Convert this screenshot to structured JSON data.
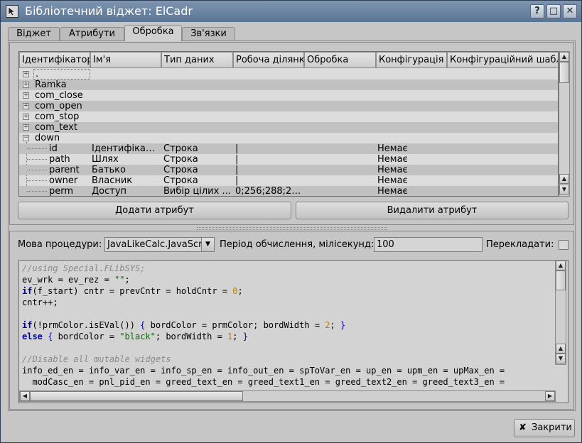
{
  "window": {
    "title": "Бібліотечний віджет: ElCadr",
    "title_buttons": [
      {
        "name": "help",
        "glyph": "?"
      },
      {
        "name": "maximize",
        "glyph": "□"
      },
      {
        "name": "close",
        "glyph": "✕"
      }
    ]
  },
  "tabs": [
    {
      "label": "Віджет",
      "active": false
    },
    {
      "label": "Атрибути",
      "active": false
    },
    {
      "label": "Обробка",
      "active": true
    },
    {
      "label": "Зв'язки",
      "active": false
    }
  ],
  "tree": {
    "columns": [
      "Ідентифікатор",
      "Ім'я",
      "Тип даних",
      "Робоча ділянка",
      "Обробка",
      "Конфігурація",
      "Конфігураційний шаблон"
    ],
    "rows": [
      {
        "id": ".",
        "level": 0,
        "expander": "+"
      },
      {
        "id": "Ramka",
        "level": 0,
        "expander": "+"
      },
      {
        "id": "com_close",
        "level": 0,
        "expander": "+"
      },
      {
        "id": "com_open",
        "level": 0,
        "expander": "+"
      },
      {
        "id": "com_stop",
        "level": 0,
        "expander": "+"
      },
      {
        "id": "com_text",
        "level": 0,
        "expander": "+"
      },
      {
        "id": "down",
        "level": 0,
        "expander": "−"
      },
      {
        "id": "id",
        "level": 1,
        "name": "Ідентифіка…",
        "type": "Строка",
        "work": "|",
        "config": "Немає"
      },
      {
        "id": "path",
        "level": 1,
        "name": "Шлях",
        "type": "Строка",
        "work": "|",
        "config": "Немає"
      },
      {
        "id": "parent",
        "level": 1,
        "name": "Батько",
        "type": "Строка",
        "work": "|",
        "config": "Немає"
      },
      {
        "id": "owner",
        "level": 1,
        "name": "Власник",
        "type": "Строка",
        "work": "|",
        "config": "Немає"
      },
      {
        "id": "perm",
        "level": 1,
        "name": "Доступ",
        "type": "Вибір цілих …",
        "work": "0;256;288;2…",
        "config": "Немає"
      }
    ]
  },
  "buttons": {
    "add_attr": "Додати атрибут",
    "del_attr": "Видалити атрибут",
    "close": "Закрити"
  },
  "procedure": {
    "lang_label": "Мова процедури:",
    "lang_value": "JavaLikeCalc.JavaScript",
    "period_label": "Період обчислення, мілісекунд:",
    "period_value": "100",
    "translate_label": "Перекладати:",
    "translate_checked": false
  },
  "code_lines": [
    [
      {
        "t": "//using Special.FLibSYS;",
        "c": "cm"
      }
    ],
    [
      {
        "t": "ev_wrk = ev_rez = ",
        "c": ""
      },
      {
        "t": "\"\"",
        "c": "st"
      },
      {
        "t": ";",
        "c": ""
      }
    ],
    [
      {
        "t": "if",
        "c": "kw"
      },
      {
        "t": "(f_start) cntr = prevCntr = holdCntr = ",
        "c": ""
      },
      {
        "t": "0",
        "c": "nm"
      },
      {
        "t": ";",
        "c": ""
      }
    ],
    [
      {
        "t": "cntr++;",
        "c": ""
      }
    ],
    [
      {
        "t": "",
        "c": ""
      }
    ],
    [
      {
        "t": "if",
        "c": "kw"
      },
      {
        "t": "(!prmColor.isEVal()) ",
        "c": ""
      },
      {
        "t": "{",
        "c": "bl"
      },
      {
        "t": " bordColor = prmColor; bordWidth = ",
        "c": ""
      },
      {
        "t": "2",
        "c": "nm"
      },
      {
        "t": "; ",
        "c": ""
      },
      {
        "t": "}",
        "c": "bl"
      }
    ],
    [
      {
        "t": "else",
        "c": "kw"
      },
      {
        "t": " ",
        "c": ""
      },
      {
        "t": "{",
        "c": "bl"
      },
      {
        "t": " bordColor = ",
        "c": ""
      },
      {
        "t": "\"black\"",
        "c": "st"
      },
      {
        "t": "; bordWidth = ",
        "c": ""
      },
      {
        "t": "1",
        "c": "nm"
      },
      {
        "t": "; ",
        "c": ""
      },
      {
        "t": "}",
        "c": "bl"
      }
    ],
    [
      {
        "t": "",
        "c": ""
      }
    ],
    [
      {
        "t": "//Disable all mutable widgets",
        "c": "cm"
      }
    ],
    [
      {
        "t": "info_ed_en = info_var_en = info_sp_en = info_out_en = spToVar_en = up_en = upm_en = upMax_en =",
        "c": ""
      }
    ],
    [
      {
        "t": "  modCasc_en = pnl_pid_en = greed_text_en = greed_text1_en = greed_text2_en = greed_text3_en =",
        "c": ""
      }
    ]
  ],
  "icons": {
    "app": "widget-icon",
    "expander_plus": "plus-box-icon",
    "expander_minus": "minus-box-icon",
    "scroll_up": "arrow-up-icon",
    "scroll_down": "arrow-down-icon",
    "close_button": "close-x-icon"
  }
}
